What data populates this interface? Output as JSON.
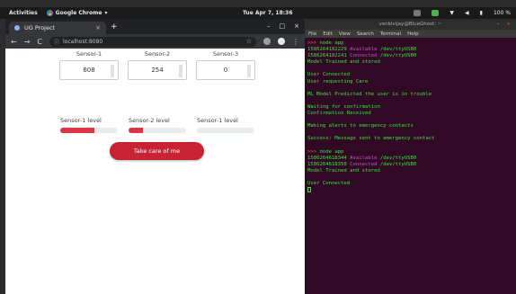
{
  "topbar": {
    "activities": "Activities",
    "app_name": "Google Chrome",
    "app_arrow": "▾",
    "clock": "Tue Apr 7, 18:36",
    "battery_text": "100 %"
  },
  "browser": {
    "tab_title": "UG Project",
    "tab_close": "×",
    "new_tab": "+",
    "min": "–",
    "max": "□",
    "close": "×",
    "back": "←",
    "forward": "→",
    "reload": "C",
    "url": "localhost:8080",
    "star": "☆",
    "menu": "⋮"
  },
  "page": {
    "sensors": [
      {
        "name": "Sensor-1",
        "value": "608"
      },
      {
        "name": "Sensor-2",
        "value": "254"
      },
      {
        "name": "Sensor-3",
        "value": "0"
      }
    ],
    "levels": [
      {
        "label": "Sensor-1 level",
        "fill": 0.59
      },
      {
        "label": "Sensor-2 level",
        "fill": 0.25
      },
      {
        "label": "Sensor-1 level",
        "fill": 0.0
      }
    ],
    "care_button": "Take care of me"
  },
  "terminal": {
    "title": "venkivijay@BlueGhost: ~",
    "menu": [
      "File",
      "Edit",
      "View",
      "Search",
      "Terminal",
      "Help"
    ],
    "lines": [
      [
        {
          "t": ">>> ",
          "c": "c-red"
        },
        {
          "t": "node app",
          "c": "c-grn"
        }
      ],
      [
        {
          "t": "1586264182229 ",
          "c": "c-grn"
        },
        {
          "t": "Available ",
          "c": "c-mag"
        },
        {
          "t": "/dev/ttyUSB0",
          "c": "c-grn"
        }
      ],
      [
        {
          "t": "1586264182241 ",
          "c": "c-grn"
        },
        {
          "t": "Connected ",
          "c": "c-mag"
        },
        {
          "t": "/dev/ttyUSB0",
          "c": "c-grn"
        }
      ],
      [
        {
          "t": "Model Trained and stored",
          "c": "c-grn"
        }
      ],
      [
        {
          "t": "",
          "c": "c-grn"
        }
      ],
      [
        {
          "t": "User Connected",
          "c": "c-grn"
        }
      ],
      [
        {
          "t": "User requesting Care",
          "c": "c-grn"
        }
      ],
      [
        {
          "t": "",
          "c": "c-grn"
        }
      ],
      [
        {
          "t": "ML Model Predicted the user is in trouble",
          "c": "c-grn"
        }
      ],
      [
        {
          "t": "",
          "c": "c-grn"
        }
      ],
      [
        {
          "t": "Waiting for confirmation",
          "c": "c-grn"
        }
      ],
      [
        {
          "t": "Confirmation Received",
          "c": "c-grn"
        }
      ],
      [
        {
          "t": "",
          "c": "c-grn"
        }
      ],
      [
        {
          "t": "Making alerts to emergency contacts",
          "c": "c-grn"
        }
      ],
      [
        {
          "t": "",
          "c": "c-grn"
        }
      ],
      [
        {
          "t": "Success: Message sent to emergency contact",
          "c": "c-grn"
        }
      ],
      [
        {
          "t": "",
          "c": "c-grn"
        }
      ],
      [
        {
          "t": ">>> ",
          "c": "c-red"
        },
        {
          "t": "node app",
          "c": "c-grn"
        }
      ],
      [
        {
          "t": "1586264618344 ",
          "c": "c-grn"
        },
        {
          "t": "Available ",
          "c": "c-mag"
        },
        {
          "t": "/dev/ttyUSB0",
          "c": "c-grn"
        }
      ],
      [
        {
          "t": "1586264618350 ",
          "c": "c-grn"
        },
        {
          "t": "Connected ",
          "c": "c-mag"
        },
        {
          "t": "/dev/ttyUSB0",
          "c": "c-grn"
        }
      ],
      [
        {
          "t": "Model Trained and stored",
          "c": "c-grn"
        }
      ],
      [
        {
          "t": "",
          "c": "c-grn"
        }
      ],
      [
        {
          "t": "User Connected",
          "c": "c-grn"
        }
      ]
    ]
  },
  "colors": {
    "accent_red": "#c82333",
    "terminal_bg": "#300a24",
    "terminal_green": "#3fe03f"
  }
}
